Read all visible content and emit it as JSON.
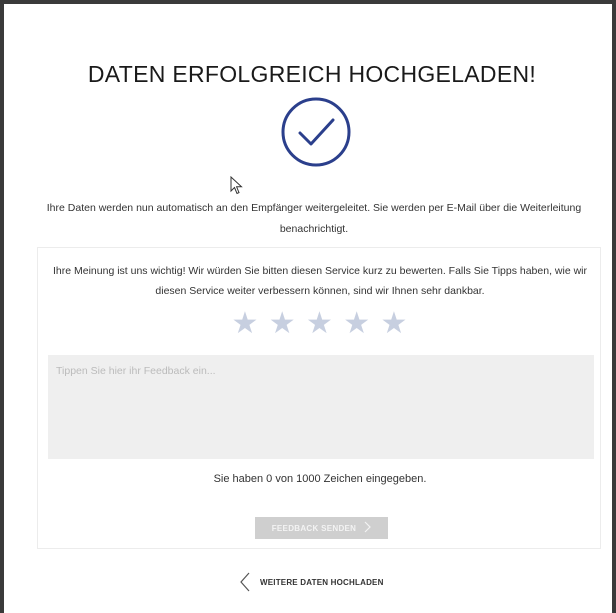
{
  "header": {
    "title": "DATEN ERFOLGREICH HOCHGELADEN!"
  },
  "status": {
    "icon": "check-circle-icon",
    "color": "#2b3f8c",
    "message": "Ihre Daten werden nun automatisch an den Empfänger weitergeleitet. Sie werden per E-Mail über die Weiterleitung benachrichtigt."
  },
  "feedback": {
    "intro": "Ihre Meinung ist uns wichtig! Wir würden Sie bitten diesen Service kurz zu bewerten. Falls Sie Tipps haben, wie wir diesen Service weiter verbessern können, sind wir Ihnen sehr dankbar.",
    "rating": {
      "value": 0,
      "max": 5,
      "star_color": "#c7cfe0"
    },
    "stars": [
      "★",
      "★",
      "★",
      "★",
      "★"
    ],
    "placeholder": "Tippen Sie hier ihr Feedback ein...",
    "value": "",
    "counter_text": "Sie haben 0 von 1000 Zeichen eingegeben.",
    "send_label": "FEEDBACK SENDEN",
    "send_icon": "chevron-right-icon"
  },
  "footer": {
    "back_label": "WEITERE DATEN HOCHLADEN",
    "back_icon": "chevron-left-icon"
  }
}
